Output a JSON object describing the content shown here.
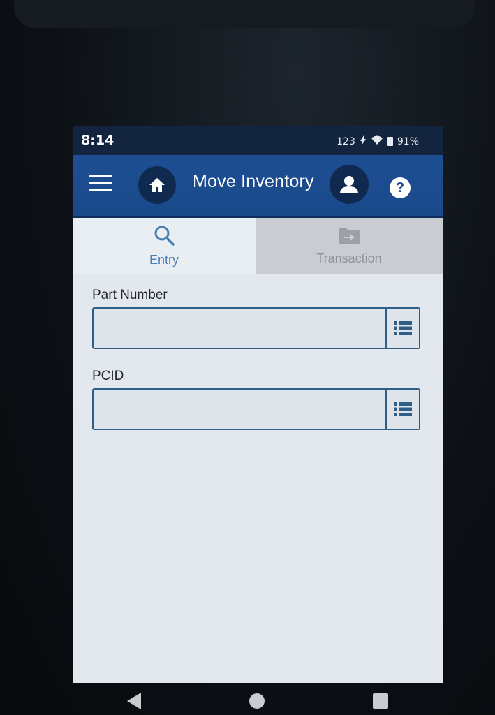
{
  "status_bar": {
    "time": "8:14",
    "battery": "91%",
    "indicators": [
      "123",
      "charging-icon",
      "wifi-icon",
      "battery-icon"
    ]
  },
  "app_bar": {
    "title": "Move Inventory",
    "menu_icon": "hamburger-menu-icon",
    "home_icon": "home-icon",
    "user_icon": "user-icon",
    "help_label": "?"
  },
  "tabs": [
    {
      "label": "Entry",
      "icon": "search-icon",
      "active": true
    },
    {
      "label": "Transaction",
      "icon": "folder-move-icon",
      "active": false
    }
  ],
  "form": {
    "part_number": {
      "label": "Part Number",
      "value": "",
      "placeholder": ""
    },
    "pcid": {
      "label": "PCID",
      "value": "",
      "placeholder": ""
    }
  },
  "nav_bar": {
    "back_icon": "back-icon",
    "home_icon": "home-circle-icon",
    "recents_icon": "recents-icon"
  },
  "colors": {
    "app_bar": "#1a4a8a",
    "status_bar": "#12243e",
    "active_tab_text": "#4a7fb4",
    "inactive_tab_bg": "#c9ccd0",
    "field_border": "#2f5f86",
    "screen_bg": "#e3e8ee"
  }
}
